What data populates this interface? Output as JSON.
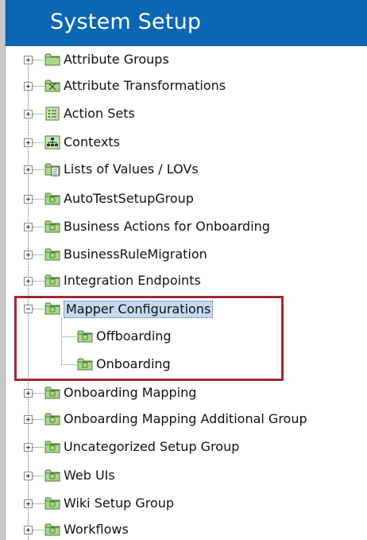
{
  "header": {
    "title": "System Setup"
  },
  "tree": {
    "items": [
      {
        "label": "Attribute Groups",
        "icon": "folder-icon"
      },
      {
        "label": "Attribute Transformations",
        "icon": "transformation-folder-icon"
      },
      {
        "label": "Action Sets",
        "icon": "action-sets-icon"
      },
      {
        "label": "Contexts",
        "icon": "contexts-hierarchy-icon"
      },
      {
        "label": "Lists of Values / LOVs",
        "icon": "lov-folder-icon"
      },
      {
        "label": "AutoTestSetupGroup",
        "icon": "setup-group-icon"
      },
      {
        "label": "Business Actions for Onboarding",
        "icon": "setup-group-icon"
      },
      {
        "label": "BusinessRuleMigration",
        "icon": "setup-group-icon"
      },
      {
        "label": "Integration Endpoints",
        "icon": "setup-group-icon"
      },
      {
        "label": "Mapper Configurations",
        "icon": "setup-group-icon",
        "expanded": true,
        "selected": true
      },
      {
        "label": "Offboarding",
        "icon": "setup-group-icon",
        "child": true
      },
      {
        "label": "Onboarding",
        "icon": "setup-group-icon",
        "child": true
      },
      {
        "label": "Onboarding Mapping",
        "icon": "setup-group-icon"
      },
      {
        "label": "Onboarding Mapping Additional Group",
        "icon": "setup-group-icon"
      },
      {
        "label": "Uncategorized Setup Group",
        "icon": "setup-group-icon"
      },
      {
        "label": "Web UIs",
        "icon": "setup-group-icon"
      },
      {
        "label": "Wiki Setup Group",
        "icon": "setup-group-icon"
      },
      {
        "label": "Workflows",
        "icon": "setup-group-icon"
      }
    ]
  },
  "colors": {
    "header_bg": "#0b67b2",
    "highlight_border": "#9e2a37",
    "selection_bg": "#c6d9f0",
    "folder_green": "#a8d88a"
  }
}
